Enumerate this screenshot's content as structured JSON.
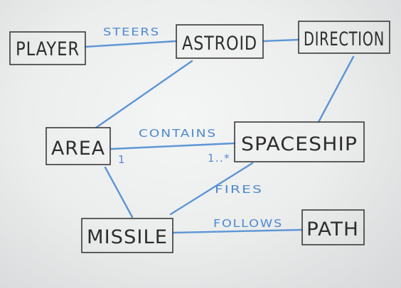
{
  "classes": {
    "player": "PLAYER",
    "astroid": "ASTROID",
    "direction": "DIRECTION",
    "area": "AREA",
    "spaceship": "SPACESHIP",
    "missile": "MISSILE",
    "path": "PATH"
  },
  "relations": {
    "steers": "STEERS",
    "contains": "CONTAINS",
    "contains_mult_area": "1",
    "contains_mult_spaceship": "1..*",
    "fires": "FIRES",
    "follows": "FOLLOWS"
  },
  "colors": {
    "ink": "#2e2e2e",
    "marker": "#5c95d6",
    "board": "#eceded"
  }
}
